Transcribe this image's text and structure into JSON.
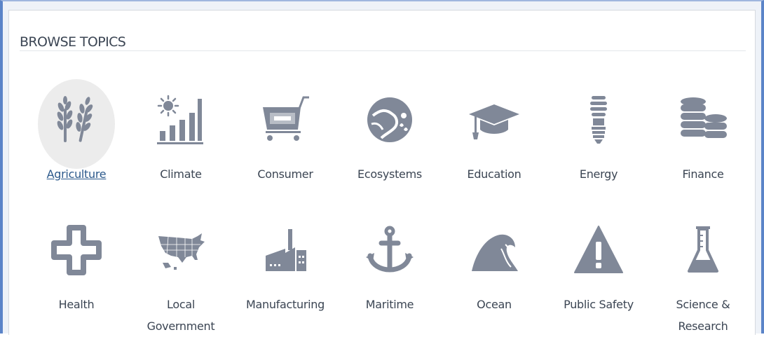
{
  "section": {
    "title": "BROWSE TOPICS"
  },
  "topics": [
    {
      "label": "Agriculture",
      "icon": "wheat-icon",
      "active": true
    },
    {
      "label": "Climate",
      "icon": "sun-bar-chart-icon",
      "active": false
    },
    {
      "label": "Consumer",
      "icon": "shopping-cart-icon",
      "active": false
    },
    {
      "label": "Ecosystems",
      "icon": "ecosystem-globe-icon",
      "active": false
    },
    {
      "label": "Education",
      "icon": "graduation-cap-icon",
      "active": false
    },
    {
      "label": "Energy",
      "icon": "light-bulb-icon",
      "active": false
    },
    {
      "label": "Finance",
      "icon": "coin-stacks-icon",
      "active": false
    },
    {
      "label": "Health",
      "icon": "medical-cross-icon",
      "active": false
    },
    {
      "label": "Local Government",
      "icon": "us-map-icon",
      "active": false
    },
    {
      "label": "Manufacturing",
      "icon": "factory-icon",
      "active": false
    },
    {
      "label": "Maritime",
      "icon": "anchor-icon",
      "active": false
    },
    {
      "label": "Ocean",
      "icon": "wave-icon",
      "active": false
    },
    {
      "label": "Public Safety",
      "icon": "warning-triangle-icon",
      "active": false
    },
    {
      "label": "Science & Research",
      "icon": "flask-icon",
      "active": false
    }
  ],
  "colors": {
    "icon": "#808898",
    "active_link": "#2d5a8c",
    "frame": "#5b84c8"
  }
}
